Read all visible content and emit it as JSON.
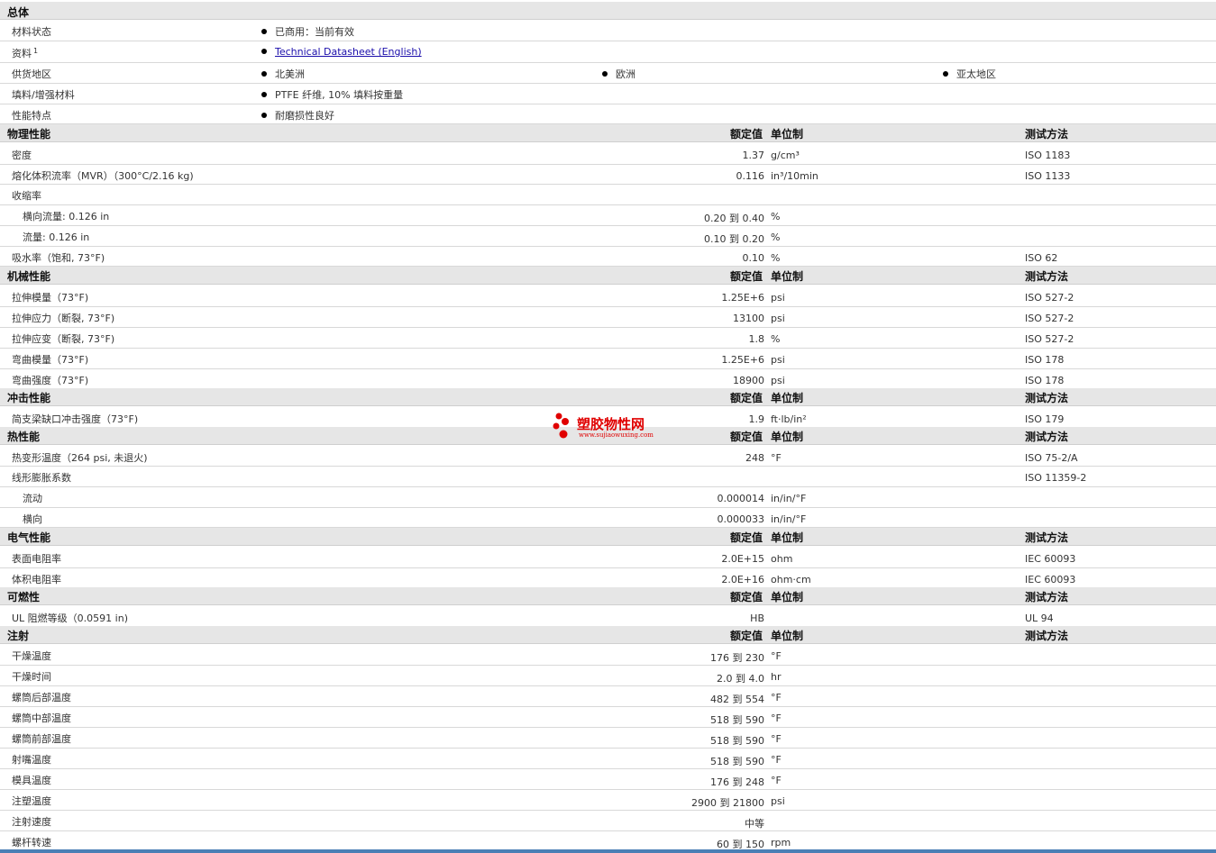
{
  "general": {
    "title": "总体",
    "rows": [
      {
        "label": "材料状态",
        "items": [
          "已商用：当前有效"
        ]
      },
      {
        "label": "资料",
        "sup": "1",
        "link": "Technical Datasheet (English)"
      },
      {
        "label": "供货地区",
        "items": [
          "北美洲",
          "欧洲",
          "亚太地区"
        ]
      },
      {
        "label": "填料/增强材料",
        "items": [
          "PTFE 纤维, 10% 填料按重量"
        ]
      },
      {
        "label": "性能特点",
        "items": [
          "耐磨损性良好"
        ]
      }
    ]
  },
  "headers": {
    "value": "额定值",
    "unit": "单位制",
    "method": "测试方法"
  },
  "physical": {
    "title": "物理性能",
    "rows": [
      {
        "label": "密度",
        "value": "1.37",
        "unit": "g/cm³",
        "method": "ISO 1183"
      },
      {
        "label": "熔化体积流率（MVR）（300°C/2.16 kg)",
        "value": "0.116",
        "unit": "in³/10min",
        "method": "ISO 1133"
      },
      {
        "label": "收缩率",
        "value": "",
        "unit": "",
        "method": ""
      },
      {
        "label": "横向流量: 0.126 in",
        "value": "0.20 到 0.40",
        "unit": "%",
        "method": "",
        "sub": true
      },
      {
        "label": "流量: 0.126 in",
        "value": "0.10 到 0.20",
        "unit": "%",
        "method": "",
        "sub": true
      },
      {
        "label": "吸水率（饱和, 73°F)",
        "value": "0.10",
        "unit": "%",
        "method": "ISO 62"
      }
    ]
  },
  "mechanical": {
    "title": "机械性能",
    "rows": [
      {
        "label": "拉伸模量（73°F)",
        "value": "1.25E+6",
        "unit": "psi",
        "method": "ISO 527-2"
      },
      {
        "label": "拉伸应力（断裂, 73°F)",
        "value": "13100",
        "unit": "psi",
        "method": "ISO 527-2"
      },
      {
        "label": "拉伸应变（断裂, 73°F)",
        "value": "1.8",
        "unit": "%",
        "method": "ISO 527-2"
      },
      {
        "label": "弯曲模量（73°F)",
        "value": "1.25E+6",
        "unit": "psi",
        "method": "ISO 178"
      },
      {
        "label": "弯曲强度（73°F)",
        "value": "18900",
        "unit": "psi",
        "method": "ISO 178"
      }
    ]
  },
  "impact": {
    "title": "冲击性能",
    "rows": [
      {
        "label": "简支梁缺口冲击强度（73°F)",
        "value": "1.9",
        "unit": "ft·lb/in²",
        "method": "ISO 179"
      }
    ]
  },
  "thermal": {
    "title": "热性能",
    "rows": [
      {
        "label": "热变形温度（264 psi, 未退火)",
        "value": "248",
        "unit": "°F",
        "method": "ISO 75-2/A"
      },
      {
        "label": "线形膨胀系数",
        "value": "",
        "unit": "",
        "method": "ISO 11359-2"
      },
      {
        "label": "流动",
        "value": "0.000014",
        "unit": "in/in/°F",
        "method": "",
        "sub": true
      },
      {
        "label": "横向",
        "value": "0.000033",
        "unit": "in/in/°F",
        "method": "",
        "sub": true
      }
    ]
  },
  "electrical": {
    "title": "电气性能",
    "rows": [
      {
        "label": "表面电阻率",
        "value": "2.0E+15",
        "unit": "ohm",
        "method": "IEC 60093"
      },
      {
        "label": "体积电阻率",
        "value": "2.0E+16",
        "unit": "ohm·cm",
        "method": "IEC 60093"
      }
    ]
  },
  "flammability": {
    "title": "可燃性",
    "rows": [
      {
        "label": "UL 阻燃等级（0.0591 in)",
        "value": "HB",
        "unit": "",
        "method": "UL 94"
      }
    ]
  },
  "injection": {
    "title": "注射",
    "rows": [
      {
        "label": "干燥温度",
        "value": "176 到 230",
        "unit": "°F",
        "method": ""
      },
      {
        "label": "干燥时间",
        "value": "2.0 到 4.0",
        "unit": "hr",
        "method": ""
      },
      {
        "label": "螺筒后部温度",
        "value": "482 到 554",
        "unit": "°F",
        "method": ""
      },
      {
        "label": "螺筒中部温度",
        "value": "518 到 590",
        "unit": "°F",
        "method": ""
      },
      {
        "label": "螺筒前部温度",
        "value": "518 到 590",
        "unit": "°F",
        "method": ""
      },
      {
        "label": "射嘴温度",
        "value": "518 到 590",
        "unit": "°F",
        "method": ""
      },
      {
        "label": "模具温度",
        "value": "176 到 248",
        "unit": "°F",
        "method": ""
      },
      {
        "label": "注塑温度",
        "value": "2900 到 21800",
        "unit": "psi",
        "method": ""
      },
      {
        "label": "注射速度",
        "value": "中等",
        "unit": "",
        "method": ""
      },
      {
        "label": "螺杆转速",
        "value": "60 到 150",
        "unit": "rpm",
        "method": ""
      }
    ]
  },
  "watermark": {
    "name": "塑胶物性网",
    "url": "www.sujiaowuxing.com"
  }
}
